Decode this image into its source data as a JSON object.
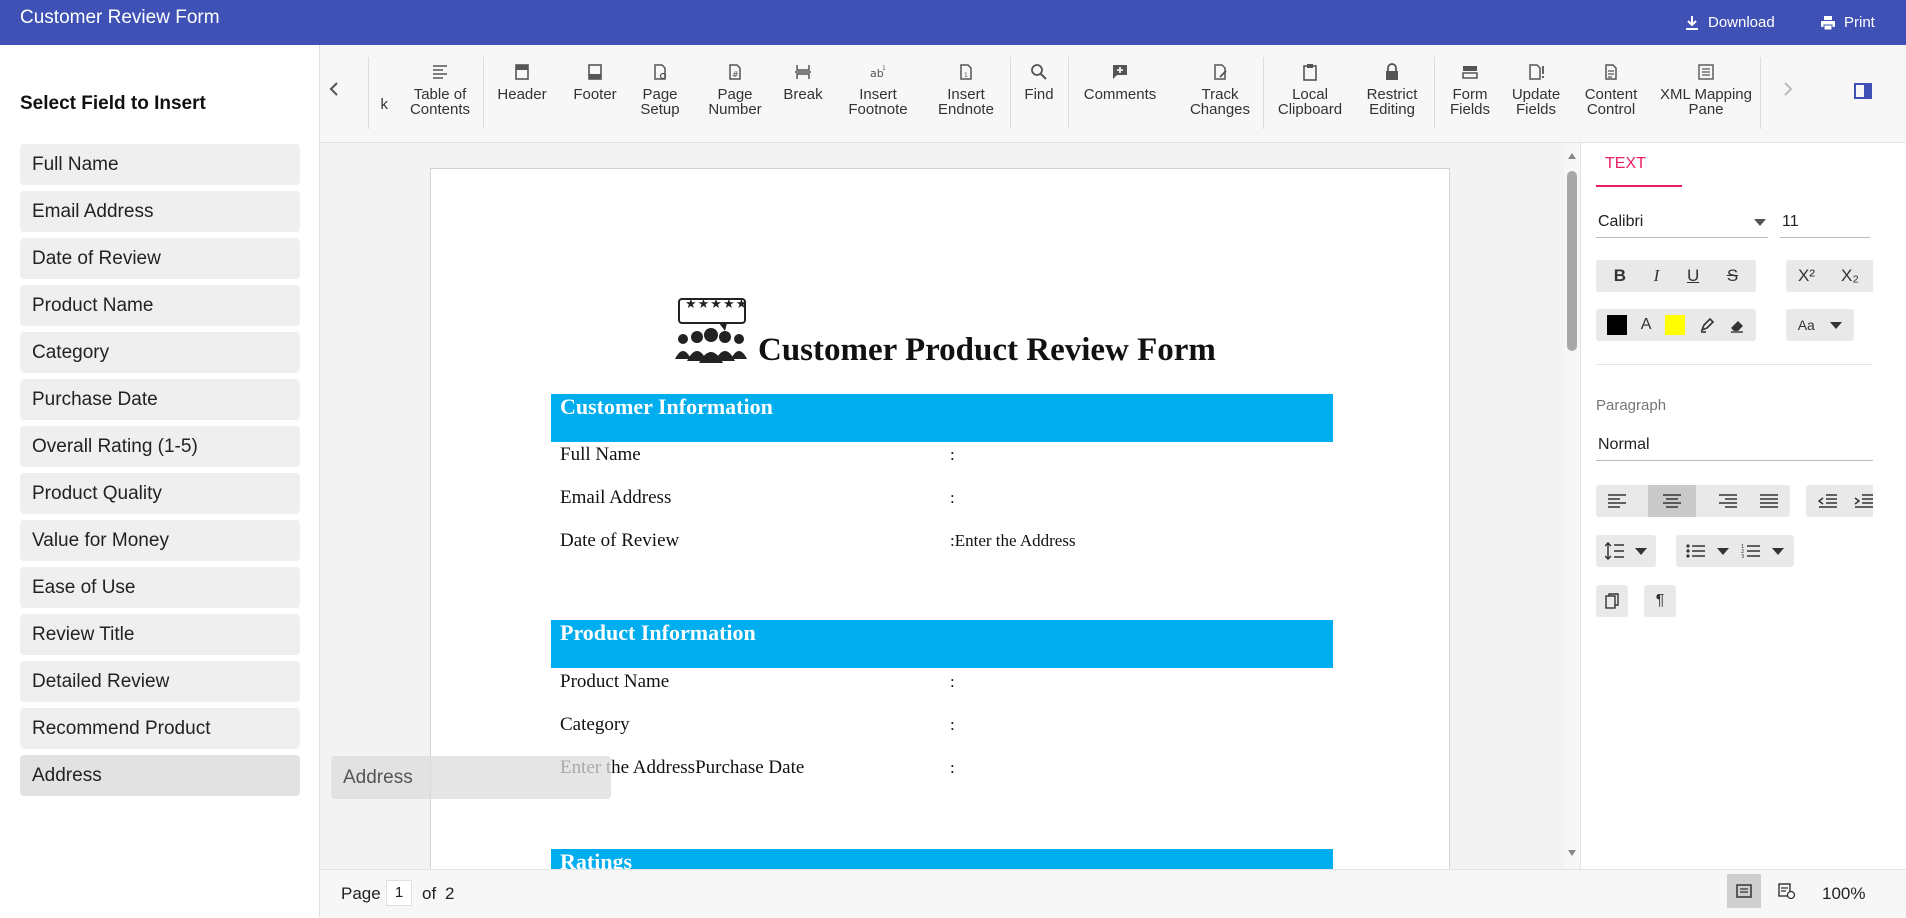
{
  "app": {
    "title": "Customer Review Form",
    "download_label": "Download",
    "print_label": "Print"
  },
  "sidebar": {
    "title": "Select Field to Insert",
    "items": [
      {
        "label": "Full Name"
      },
      {
        "label": "Email Address"
      },
      {
        "label": "Date of Review"
      },
      {
        "label": "Product Name"
      },
      {
        "label": "Category"
      },
      {
        "label": "Purchase Date"
      },
      {
        "label": "Overall Rating (1-5)"
      },
      {
        "label": "Product Quality"
      },
      {
        "label": "Value for Money"
      },
      {
        "label": "Ease of Use"
      },
      {
        "label": "Review Title"
      },
      {
        "label": "Detailed Review"
      },
      {
        "label": "Recommend Product"
      },
      {
        "label": "Address"
      }
    ]
  },
  "toolbar": {
    "partial_label": "k",
    "tools": [
      {
        "label": "Table of Contents",
        "icon": "table-of-contents-icon"
      },
      {
        "label": "Header",
        "icon": "header-icon"
      },
      {
        "label": "Footer",
        "icon": "footer-icon"
      },
      {
        "label": "Page Setup",
        "icon": "page-setup-icon"
      },
      {
        "label": "Page Number",
        "icon": "page-number-icon"
      },
      {
        "label": "Break",
        "icon": "break-icon"
      },
      {
        "label": "Insert Footnote",
        "icon": "footnote-icon"
      },
      {
        "label": "Insert Endnote",
        "icon": "endnote-icon"
      },
      {
        "label": "Find",
        "icon": "search-icon"
      },
      {
        "label": "Comments",
        "icon": "comment-icon"
      },
      {
        "label": "Track Changes",
        "icon": "track-changes-icon"
      },
      {
        "label": "Local Clipboard",
        "icon": "clipboard-icon"
      },
      {
        "label": "Restrict Editing",
        "icon": "lock-icon"
      },
      {
        "label": "Form Fields",
        "icon": "form-fields-icon"
      },
      {
        "label": "Update Fields",
        "icon": "update-fields-icon"
      },
      {
        "label": "Content Control",
        "icon": "content-control-icon"
      },
      {
        "label": "XML Mapping Pane",
        "icon": "xml-mapping-icon"
      }
    ]
  },
  "document": {
    "title": "Customer Product Review Form",
    "logo_stars": "★★★★★",
    "sections": [
      {
        "heading": "Customer Information",
        "rows": [
          {
            "label": "Full Name",
            "value": ":"
          },
          {
            "label": "Email Address",
            "value": ":"
          },
          {
            "label": "Date of Review",
            "value": ":Enter the Address"
          }
        ]
      },
      {
        "heading": "Product Information",
        "rows": [
          {
            "label": "Product Name",
            "value": ":"
          },
          {
            "label": "Category",
            "value": ":"
          },
          {
            "label": "Enter the AddressPurchase Date",
            "value": ":"
          }
        ]
      },
      {
        "heading": "Ratings",
        "rows": []
      }
    ],
    "drag_ghost": "Address"
  },
  "properties": {
    "tab": "TEXT",
    "font_family": "Calibri",
    "font_size": "11",
    "case_label": "Aa",
    "paragraph_label": "Paragraph",
    "style": "Normal",
    "highlight_color": "#ffff00",
    "font_color": "#000000"
  },
  "status": {
    "page_label": "Page",
    "page_number": "1",
    "of_label": "of",
    "total_pages": "2",
    "zoom": "100%"
  },
  "colors": {
    "header_bar": "#3f51b5",
    "section_band": "#00adef",
    "active_tab": "#e91e63"
  }
}
